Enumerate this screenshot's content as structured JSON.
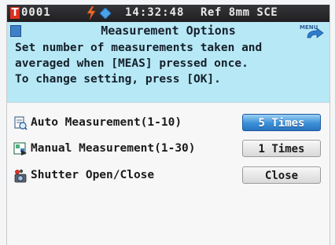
{
  "status_bar": {
    "sample_no": "0001",
    "time": "14:32:48",
    "condition": "Ref 8mm SCE"
  },
  "header": {
    "title": "Measurement Options",
    "menu_label": "MENU",
    "description": "Set number of measurements taken and\naveraged when [MEAS] pressed once.\nTo change setting, press [OK]."
  },
  "options": [
    {
      "label": "Auto Measurement(1-10)",
      "value": "5 Times",
      "selected": true,
      "icon": "auto-measurement-icon"
    },
    {
      "label": "Manual Measurement(1-30)",
      "value": "1 Times",
      "selected": false,
      "icon": "manual-measurement-icon"
    },
    {
      "label": "Shutter Open/Close",
      "value": "Close",
      "selected": false,
      "icon": "shutter-icon"
    }
  ],
  "colors": {
    "header_bg": "#b7e8f6",
    "status_bar_bg": "#2a2a2e",
    "selected_accent": "#3b8fd8",
    "status_alert": "#e0301e"
  }
}
